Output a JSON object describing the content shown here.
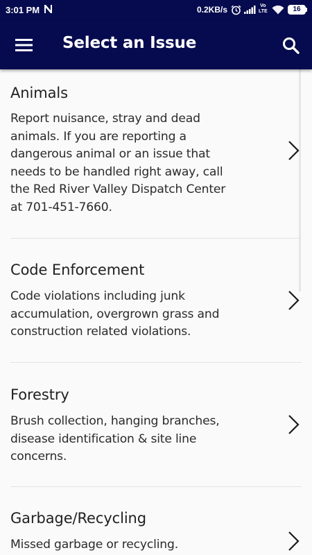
{
  "status_bar": {
    "time": "3:01 PM",
    "network_speed": "0.2KB/s",
    "volte_top": "Vo",
    "volte_bottom": "LTE",
    "battery": "16"
  },
  "app_bar": {
    "title": "Select an Issue",
    "menu_icon": "hamburger-menu-icon",
    "search_icon": "search-icon",
    "background_color": "#060b4f"
  },
  "issues": [
    {
      "title": "Animals",
      "description": "Report nuisance, stray and dead animals. If you are reporting a dangerous animal or an issue that needs to be handled right away, call the Red River Valley Dispatch Center at 701-451-7660."
    },
    {
      "title": "Code Enforcement",
      "description": "Code violations including junk accumulation, overgrown grass and construction related violations."
    },
    {
      "title": "Forestry",
      "description": "Brush collection, hanging branches, disease identification & site line concerns."
    },
    {
      "title": "Garbage/Recycling",
      "description": "Missed garbage or recycling."
    }
  ]
}
